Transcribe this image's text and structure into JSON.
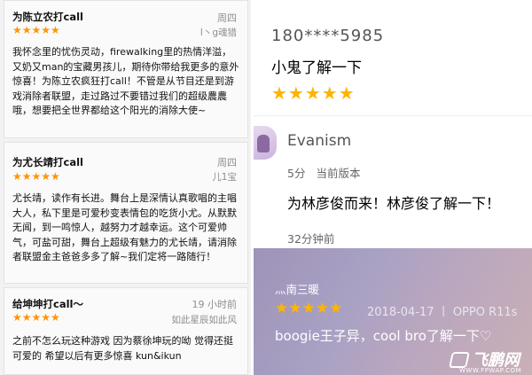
{
  "left_reviews": [
    {
      "title": "为陈立农打call",
      "date": "周四",
      "stars": "★★★★★",
      "user": "l丶g魂猎",
      "body": "我怀念里的忧伤灵动，firewalking里的热情洋溢，又奶又man的宝藏男孩儿，期待你带给我更多的意外惊喜！为陈立农疯狂打call！不管是从节目还是到游戏消除者联盟，走过路过不要错过我们的超级農農哦，想要把全世界都给这个阳光的消除大使~"
    },
    {
      "title": "为尤长靖打call",
      "date": "周四",
      "stars": "★★★★★",
      "user": "儿1宝",
      "body": "尤长靖，读作有长进。舞台上是深情认真歌唱的主唱大人，私下里是可爱秒变表情包的吃货小尤。从默默无闻，到一鸣惊人，越努力才越幸运。这个可爱帅气，可盐可甜，舞台上超级有魅力的尤长靖，请消除者联盟金主爸爸多多了解~我们定将一路随行！"
    },
    {
      "title": "给坤坤打call～",
      "date": "19 小时前",
      "stars": "★★★★★",
      "user": "如此星辰如此风",
      "body": "之前不怎么玩这种游戏 因为蔡徐坤玩的呦 觉得还挺可爱的 希望以后有更多惊喜 kun&ikun"
    }
  ],
  "right_top": {
    "phone": "180****5985",
    "text": "小鬼了解一下",
    "stars": "★★★★★"
  },
  "right_middle": {
    "name": "Evanism",
    "score": "5分",
    "version": "当前版本",
    "text": "为林彦俊而来！林彦俊了解一下！",
    "time": "32分钟前"
  },
  "right_bottom": {
    "name": "灬南三暖",
    "stars": "★★★★★",
    "date": "2018-04-17 丨 OPPO R11s",
    "text": "boogie王子异，cool bro了解一下♡",
    "watermark": "飞鹏网",
    "watermark_url": "WWW.FPWAP.COM"
  },
  "colors": {
    "star_orange": "#ff9500",
    "star_yellow": "#ffb400",
    "meta_gray": "#8e8e93"
  }
}
